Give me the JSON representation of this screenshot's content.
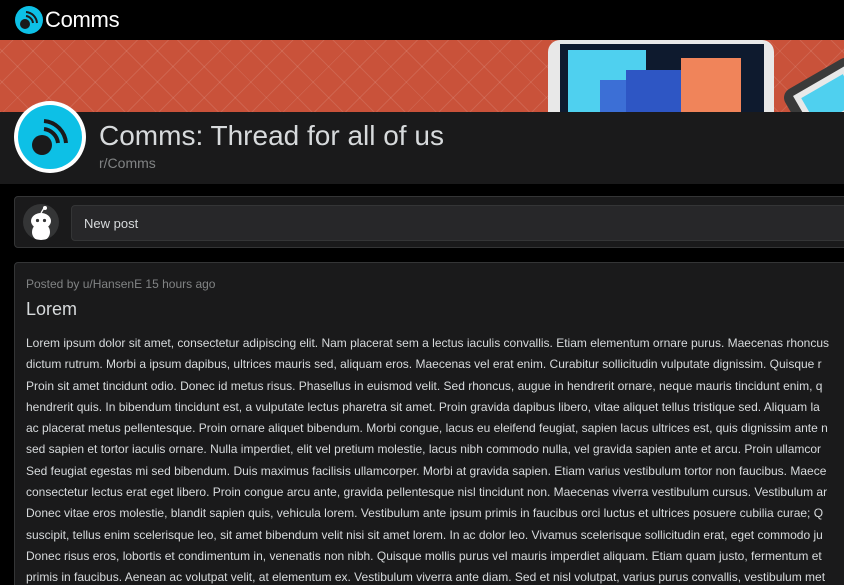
{
  "app": {
    "name": "Comms"
  },
  "community": {
    "title": "Comms: Thread for all of us",
    "subreddit": "r/Comms"
  },
  "new_post": {
    "placeholder": "New post"
  },
  "post": {
    "meta": "Posted by u/HansenE 15 hours ago",
    "title": "Lorem",
    "body_lines": [
      "Lorem ipsum dolor sit amet, consectetur adipiscing elit. Nam placerat sem a lectus iaculis convallis. Etiam elementum ornare purus. Maecenas rhoncus",
      "dictum rutrum. Morbi a ipsum dapibus, ultrices mauris sed, aliquam eros. Maecenas vel erat enim. Curabitur sollicitudin vulputate dignissim. Quisque r",
      "Proin sit amet tincidunt odio. Donec id metus risus. Phasellus in euismod velit. Sed rhoncus, augue in hendrerit ornare, neque mauris tincidunt enim, q",
      "hendrerit quis. In bibendum tincidunt est, a vulputate lectus pharetra sit amet. Proin gravida dapibus libero, vitae aliquet tellus tristique sed. Aliquam la",
      "ac placerat metus pellentesque. Proin ornare aliquet bibendum. Morbi congue, lacus eu eleifend feugiat, sapien lacus ultrices est, quis dignissim ante n",
      "sed sapien et tortor iaculis ornare. Nulla imperdiet, elit vel pretium molestie, lacus nibh commodo nulla, vel gravida sapien ante et arcu. Proin ullamcor",
      "Sed feugiat egestas mi sed bibendum. Duis maximus facilisis ullamcorper. Morbi at gravida sapien. Etiam varius vestibulum tortor non faucibus. Maece",
      "consectetur lectus erat eget libero. Proin congue arcu ante, gravida pellentesque nisl tincidunt non. Maecenas viverra vestibulum cursus. Vestibulum ar",
      "Donec vitae eros molestie, blandit sapien quis, vehicula lorem. Vestibulum ante ipsum primis in faucibus orci luctus et ultrices posuere cubilia curae; Q",
      "suscipit, tellus enim scelerisque leo, sit amet bibendum velit nisi sit amet lorem. In ac dolor leo. Vivamus scelerisque sollicitudin erat, eget commodo ju",
      "Donec risus eros, lobortis et condimentum in, venenatis non nibh. Quisque mollis purus vel mauris imperdiet aliquam. Etiam quam justo, fermentum et",
      "primis in faucibus. Aenean ac volutpat velit, at elementum ex. Vestibulum viverra ante diam. Sed et nisl volutpat, varius purus convallis, vestibulum met"
    ]
  },
  "icons": {
    "app_logo": "satellite-dish-icon",
    "community_icon": "satellite-dish-icon",
    "user_avatar": "snoo-avatar-icon"
  },
  "colors": {
    "accent": "#0dc0e6",
    "banner": "#c9523a",
    "card": "#1a1a1b",
    "text": "#d7dadc",
    "muted": "#818384"
  }
}
